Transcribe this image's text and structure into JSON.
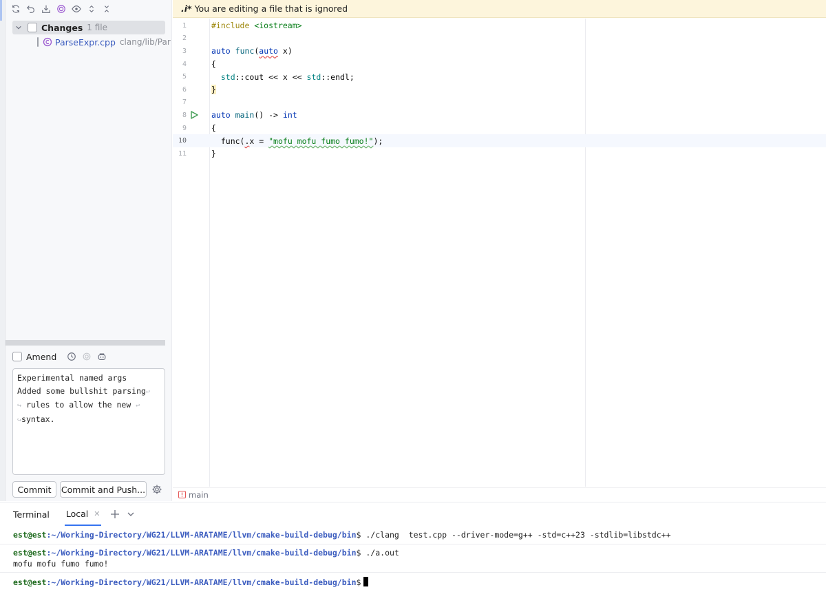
{
  "toolbar": {
    "icons": [
      "refresh-icon",
      "rollback-icon",
      "update-icon",
      "shelve-icon",
      "show-diff-icon",
      "expand-icon",
      "collapse-icon"
    ]
  },
  "changes": {
    "label": "Changes",
    "count": "1 file",
    "file": {
      "name": "ParseExpr.cpp",
      "path": "clang/lib/Parse"
    }
  },
  "commit": {
    "amend_label": "Amend",
    "message_lines": [
      "Experimental named args",
      "Added some bullshit parsing",
      " rules to allow the new ",
      "syntax."
    ],
    "commit_button": "Commit",
    "commit_push_button": "Commit and Push..."
  },
  "editor": {
    "banner_icon": ".i*",
    "banner_text": "You are editing a file that is ignored",
    "current_line": 10,
    "line_numbers": [
      "1",
      "2",
      "3",
      "4",
      "5",
      "6",
      "7",
      "8",
      "9",
      "10",
      "11"
    ],
    "branch": "main"
  },
  "code": {
    "l1_directive": "#include",
    "l1_header": "<iostream>",
    "l3_auto": "auto",
    "l3_func": "func",
    "l3_param_type": "auto",
    "l3_param": "x",
    "l5_std1": "std",
    "l5_cout": "cout",
    "l5_mid": " << x << ",
    "l5_std2": "std",
    "l5_endl": "endl",
    "l8_auto": "auto",
    "l8_main": "main",
    "l8_arrow": "() -> ",
    "l8_int": "int",
    "l10_call": "func(",
    "l10_dot": ".",
    "l10_assign": "x = ",
    "l10_string": "\"mofu mofu fumo fumo!\"",
    "l10_end": ");"
  },
  "terminal": {
    "title": "Terminal",
    "tab_label": "Local",
    "prompt_user": "est@est",
    "prompt_path": ":~/Working-Directory/WG21/LLVM-ARATAME/llvm/cmake-build-debug/bin",
    "cmd1": " ./clang  test.cpp --driver-mode=g++ -std=c++23 -stdlib=libstdc++",
    "cmd2": " ./a.out",
    "output": "mofu mofu fumo fumo!"
  }
}
